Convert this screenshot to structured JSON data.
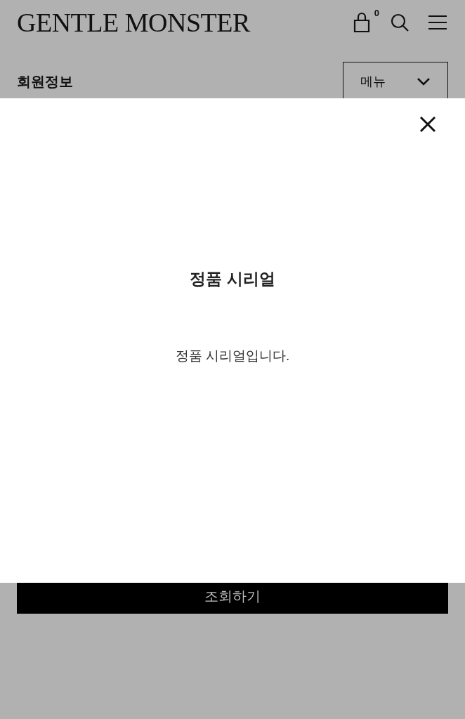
{
  "header": {
    "logo": "GENTLE MONSTER",
    "cart_count": "0"
  },
  "page": {
    "title": "회원정보",
    "menu_dropdown": "메뉴",
    "submit_button": "조회하기"
  },
  "modal": {
    "title": "정품 시리얼",
    "message": "정품 시리얼입니다.",
    "open": true
  }
}
